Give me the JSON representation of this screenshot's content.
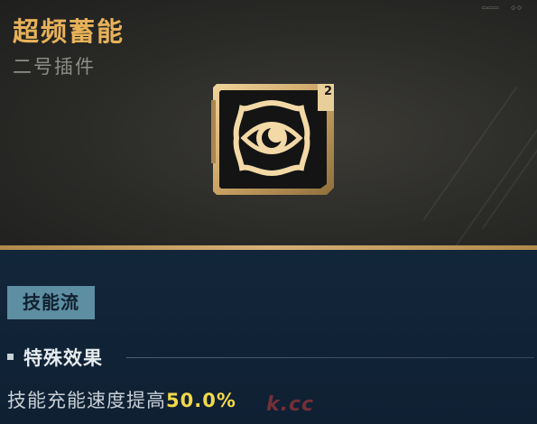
{
  "item": {
    "title": "超频蓄能",
    "subtitle": "二号插件",
    "slot_number": "2",
    "icon": "eye-icon"
  },
  "category": {
    "tag": "技能流"
  },
  "effects": {
    "section_title": "特殊效果",
    "description": "技能充能速度提高",
    "value": "50.0%"
  },
  "watermark": "k.cc",
  "colors": {
    "title_gold": "#e8b25a",
    "accent_gold": "#d6b276",
    "tag_bg": "#5d8ea1",
    "value_yellow": "#f2d84a",
    "panel_dark": "#2a2a27",
    "panel_navy": "#12263a"
  }
}
